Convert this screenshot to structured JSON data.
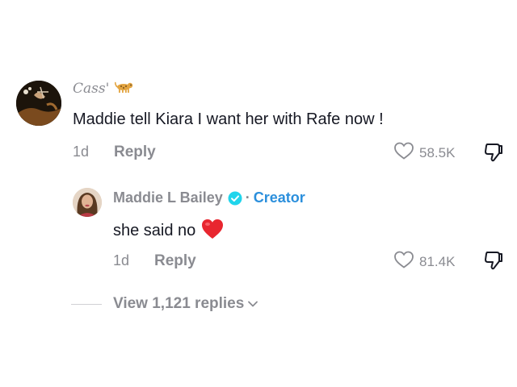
{
  "comment": {
    "author": "Cass'",
    "text": "Maddie tell Kiara I want her with Rafe now !",
    "time": "1d",
    "reply_label": "Reply",
    "likes": "58.5K"
  },
  "reply": {
    "author": "Maddie L Bailey",
    "separator": "·",
    "creator_label": "Creator",
    "text": "she said no",
    "time": "1d",
    "reply_label": "Reply",
    "likes": "81.4K"
  },
  "view_replies": {
    "label": "View 1,121 replies"
  },
  "colors": {
    "text": "#161823",
    "muted": "#8a8b91",
    "verified": "#20d5ec",
    "creator": "#2b8fdc",
    "heart_emoji": "#e8262f"
  },
  "icons": [
    "leopard-emoji-icon",
    "verified-badge-icon",
    "heart-emoji-icon",
    "heart-outline-icon",
    "thumbs-down-icon",
    "chevron-down-icon"
  ]
}
